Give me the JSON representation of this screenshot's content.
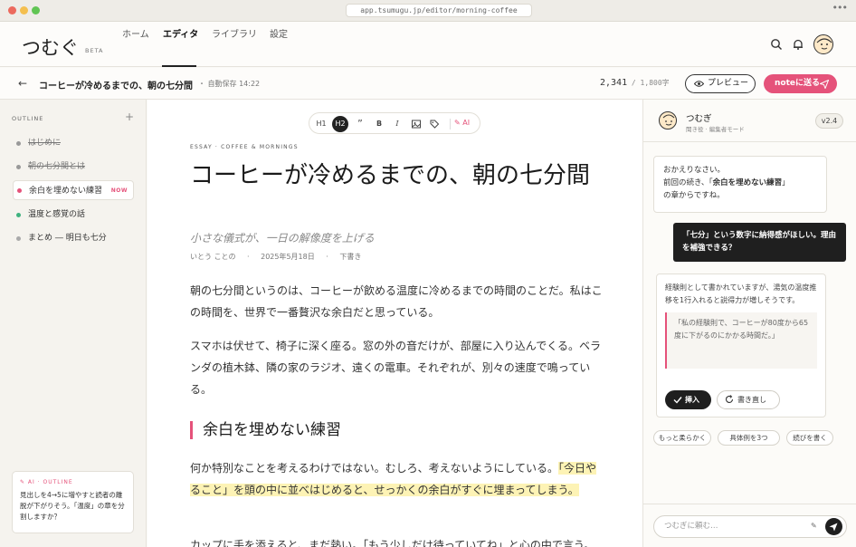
{
  "browser": {
    "url": "app.tsumugu.jp/editor/morning-coffee",
    "more": "•••"
  },
  "header": {
    "logo": "つむぐ",
    "beta": "BETA",
    "nav": [
      {
        "label": "ホーム"
      },
      {
        "label": "エディタ"
      },
      {
        "label": "ライブラリ"
      },
      {
        "label": "設定"
      }
    ]
  },
  "docbar": {
    "back": "←",
    "title": "コーヒーが冷めるまでの、朝の七分間",
    "autosave": "・ 自動保存 14:22",
    "count": "2,341",
    "limit": " / 1,800字",
    "preview": "プレビュー",
    "send": "noteに送る"
  },
  "outline": {
    "heading": "OUTLINE",
    "add": "+",
    "items": [
      {
        "label": "はじめに"
      },
      {
        "label": "朝の七分間とは"
      },
      {
        "label": "余白を埋めない練習",
        "badge": "NOW"
      },
      {
        "label": "温度と感覚の話"
      },
      {
        "label": "まとめ ― 明日も七分"
      }
    ],
    "ai_heading": "✎ AI · OUTLINE",
    "ai_text": "見出しを4→5に増やすと読者の離脱が下がりそう。「温度」の章を分割しますか？"
  },
  "toolbar": {
    "h1": "H1",
    "h2": "H2",
    "quote": "”",
    "bold": "B",
    "italic": "I",
    "ai": "✎ AI"
  },
  "article": {
    "eyebrow": "ESSAY · COFFEE & MORNINGS",
    "title": "コーヒーが冷めるまでの、朝の七分間",
    "subtitle": "小さな儀式が、一日の解像度を上げる",
    "author": "いとう ことの",
    "date": "2025年5月18日",
    "status": "下書き",
    "p1": "朝の七分間というのは、コーヒーが飲める温度に冷めるまでの時間のことだ。私はこの時間を、世界で一番贅沢な余白だと思っている。",
    "p2": "スマホは伏せて、椅子に深く座る。窓の外の音だけが、部屋に入り込んでくる。ベランダの植木鉢、隣の家のラジオ、遠くの電車。それぞれが、別々の速度で鳴っている。",
    "h2": "余白を埋めない練習",
    "p3a": "何か特別なことを考えるわけではない。むしろ、考えないようにしている。",
    "p3b": "「今日やること」を頭の中に並べはじめると、せっかくの余白がすぐに埋まってしまう。",
    "p4": "カップに手を添えると、まだ熱い。「もう少しだけ待っていてね」と心の中で言う。"
  },
  "assistant": {
    "name": "つむぎ",
    "role": "聞き役 · 編集者モード",
    "version": "v2.4",
    "greet1": "おかえりなさい。",
    "greet2a": "前回の続き、「",
    "greet2b": "余白を埋めない練習",
    "greet2c": "」",
    "greet3": "の章からですね。",
    "user_msg": "「七分」という数字に納得感がほしい。理由を補強できる？",
    "reply": "経験則として書かれていますが、湯気の温度推移を1行入れると説得力が増しそうです。",
    "quote": "「私の経験則で、コーヒーが80度から65度に下がるのにかかる時間だ。」",
    "insert": "挿入",
    "rewrite": "書き直し",
    "chips": [
      {
        "label": "もっと柔らかく"
      },
      {
        "label": "具体例を3つ"
      },
      {
        "label": "続びを書く"
      }
    ],
    "input_placeholder": "つむぎに頼む…"
  },
  "colors": {
    "accent": "#e5527a",
    "ink": "#1f1f1f",
    "highlight": "#fdf3b5",
    "green": "#3fb27f"
  }
}
